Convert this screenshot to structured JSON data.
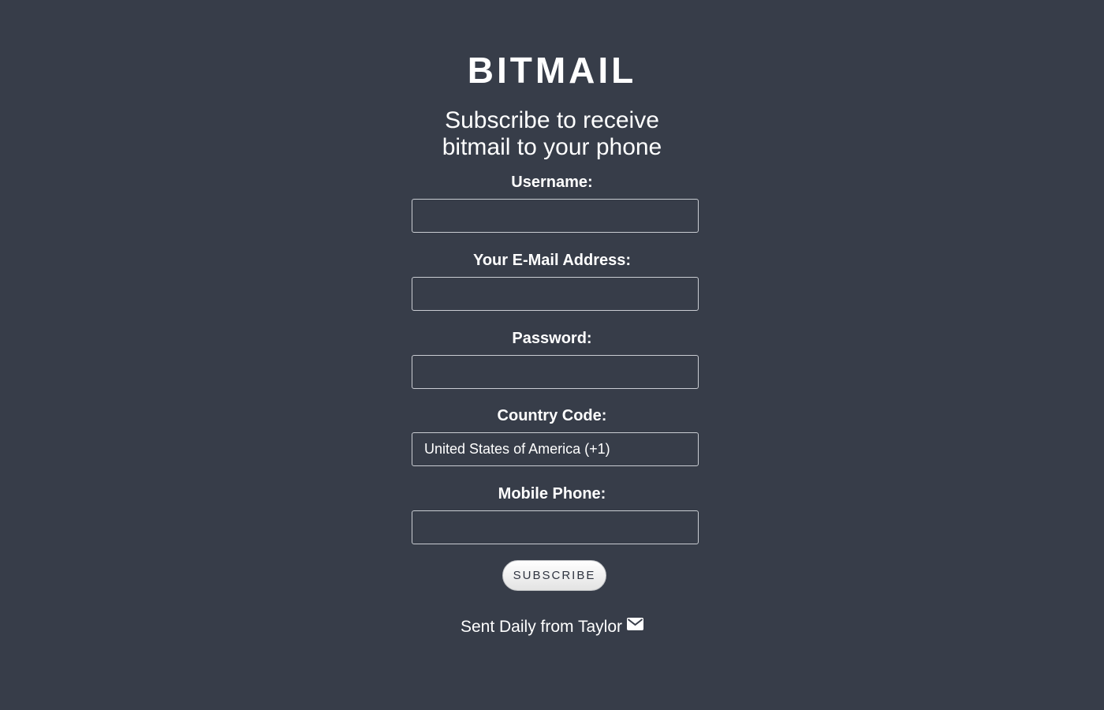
{
  "header": {
    "logo": "BITMAIL",
    "tagline_line1": "Subscribe to receive",
    "tagline_line2": "bitmail to your phone"
  },
  "form": {
    "username": {
      "label": "Username:",
      "value": ""
    },
    "email": {
      "label": "Your E-Mail Address:",
      "value": ""
    },
    "password": {
      "label": "Password:",
      "value": ""
    },
    "country": {
      "label": "Country Code:",
      "selected": "United States of America (+1)"
    },
    "phone": {
      "label": "Mobile Phone:",
      "value": ""
    },
    "submit_label": "SUBSCRIBE"
  },
  "footer": {
    "text": "Sent Daily from Taylor",
    "icon": "envelope-icon"
  },
  "colors": {
    "background": "#373d49",
    "text": "#ffffff",
    "input_border": "#c9ccd2"
  }
}
